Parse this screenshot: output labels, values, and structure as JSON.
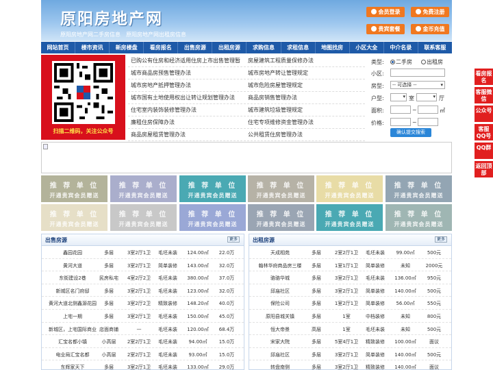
{
  "header": {
    "logo": "原阳房地产网",
    "subtitle": "原阳房地产网二手房信息　原阳房地产网出租房信息",
    "buttons": [
      "会员登录",
      "免费注册",
      "贵宾套餐",
      "金币充值"
    ]
  },
  "nav": [
    "网站首页",
    "楼市资讯",
    "新房楼盘",
    "看房报名",
    "出售房源",
    "出租房源",
    "求购信息",
    "求租信息",
    "地图找房",
    "小区大全",
    "中介名录",
    "联系客服"
  ],
  "qr": {
    "caption": "扫描二维码，关注公众号"
  },
  "links": [
    [
      "已购公有住房和经济适用住房上市出售管理暂",
      "房屋建筑工程质量保修办法"
    ],
    [
      "城市商品房预售管理办法",
      "城市房地产转让管理规定"
    ],
    [
      "城市房地产抵押管理办法",
      "城市危险房屋管理规定"
    ],
    [
      "城市国有土地使用权出让转让规划管理办法",
      "商品房销售管理办法"
    ],
    [
      "住宅室内装饰装修管理办法",
      "城市建筑垃圾管理规定"
    ],
    [
      "廉租住房保障办法",
      "住宅专项维修资金管理办法"
    ],
    [
      "商品房屋租赁管理办法",
      "公共租赁住房管理办法"
    ]
  ],
  "search": {
    "type_label": "类型:",
    "type_options": [
      "二手房",
      "出租房"
    ],
    "community_label": "小区:",
    "housetype_label": "房型:",
    "housetype_select": "-- 可选择 --",
    "layout_label": "户型:",
    "room_unit": "室",
    "hall_unit": "厅",
    "area_label": "面积:",
    "area_unit": "㎡",
    "price_label": "价格:",
    "range_sep": "~",
    "submit": "确认提交搜索"
  },
  "tiles": {
    "line1": "推 荐 单 位",
    "line2": "开通贵宾会员赠送"
  },
  "tile_colors": [
    "#b3b39a",
    "#aaaecc",
    "#4aa9b3",
    "#b6b2a6",
    "#e8dca6",
    "#93a5b3",
    "#e6dfc7",
    "#c8c8c8",
    "#9aa8d6",
    "#9aa5b3",
    "#4aa9b3",
    "#9fb6b3"
  ],
  "sale": {
    "title": "出售房源",
    "more": "更多",
    "rows": [
      [
        "鑫园花园",
        "多层",
        "3室2厅1卫",
        "毛坯未装",
        "124.00㎡",
        "22.0万"
      ],
      [
        "黄河大道",
        "多层",
        "3室2厅1卫",
        "简单装修",
        "143.00㎡",
        "32.0万"
      ],
      [
        "东街建设2巷",
        "民房私宅",
        "4室2厅2卫",
        "毛坯未装",
        "380.00㎡",
        "37.0万"
      ],
      [
        "新城区名门府邸",
        "多层",
        "3室2厅1卫",
        "毛坯未装",
        "123.00㎡",
        "32.0万"
      ],
      [
        "黄河大道北侧鑫源花园",
        "多层",
        "3室2厅2卫",
        "精致装修",
        "148.20㎡",
        "40.0万"
      ],
      [
        "上宅一期",
        "多层",
        "3室2厅1卫",
        "毛坯未装",
        "150.00㎡",
        "45.0万"
      ],
      [
        "新城区，上宅国际商业",
        "店面商铺",
        "—",
        "毛坯未装",
        "120.00㎡",
        "68.4万"
      ],
      [
        "汇宝名都小镇",
        "小高层",
        "2室2厅1卫",
        "毛坯未装",
        "94.00㎡",
        "15.0万"
      ],
      [
        "电业局汇宝名都",
        "小高层",
        "2室2厅1卫",
        "毛坯未装",
        "93.00㎡",
        "15.0万"
      ],
      [
        "东辉家天下",
        "多层",
        "3室2厅1卫",
        "毛坯未装",
        "133.00㎡",
        "29.0万"
      ]
    ]
  },
  "rent": {
    "title": "出租房源",
    "more": "更多",
    "rows": [
      [
        "天成相苑",
        "多层",
        "2室2厅1卫",
        "毛坯未装",
        "99.00㎡",
        "500元"
      ],
      [
        "翰林华府商品房三楼",
        "多层",
        "1室1厅1卫",
        "简单装修",
        "未知",
        "2000元"
      ],
      [
        "骆骆华城",
        "多层",
        "3室2厅1卫",
        "毛坯未装",
        "136.00㎡",
        "950元"
      ],
      [
        "邱庙社区",
        "多层",
        "3室2厅1卫",
        "简单装修",
        "140.00㎡",
        "500元"
      ],
      [
        "保险公司",
        "多层",
        "1室2厅1卫",
        "简单装修",
        "56.00㎡",
        "550元"
      ],
      [
        "原阳县城关镇",
        "多层",
        "1室",
        "中档装修",
        "未知",
        "800元"
      ],
      [
        "恒大帝景",
        "高层",
        "1室",
        "毛坯未装",
        "未知",
        "500元"
      ],
      [
        "宋家大院",
        "多层",
        "5室4厅1卫",
        "精致装修",
        "100.00㎡",
        "面议"
      ],
      [
        "邱庙社区",
        "多层",
        "3室2厅1卫",
        "简单装修",
        "140.00㎡",
        "500元"
      ],
      [
        "转盘南侧",
        "多层",
        "3室2厅1卫",
        "精致装修",
        "140.00㎡",
        "面议"
      ]
    ]
  },
  "side": [
    "看房报名",
    "客服微信",
    "公众号",
    "客服QQ号",
    "QQ群",
    "返回顶部"
  ]
}
